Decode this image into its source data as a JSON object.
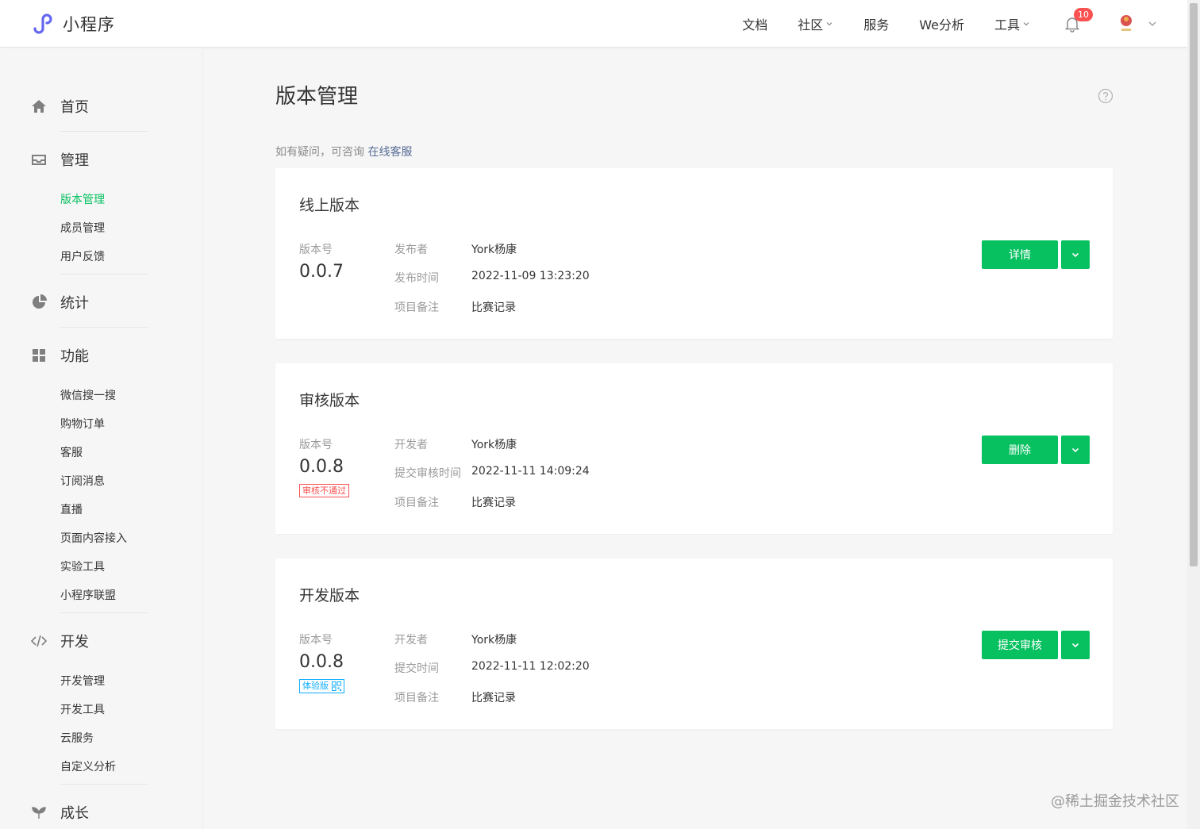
{
  "header": {
    "app_title": "小程序",
    "nav": [
      {
        "label": "文档",
        "has_dropdown": false
      },
      {
        "label": "社区",
        "has_dropdown": true
      },
      {
        "label": "服务",
        "has_dropdown": false
      },
      {
        "label": "We分析",
        "has_dropdown": false
      },
      {
        "label": "工具",
        "has_dropdown": true
      }
    ],
    "notification_count": "10"
  },
  "sidebar": {
    "sections": [
      {
        "label": "首页",
        "icon": "home-icon",
        "items": []
      },
      {
        "label": "管理",
        "icon": "inbox-icon",
        "items": [
          "版本管理",
          "成员管理",
          "用户反馈"
        ]
      },
      {
        "label": "统计",
        "icon": "pie-chart-icon",
        "items": []
      },
      {
        "label": "功能",
        "icon": "grid-icon",
        "items": [
          "微信搜一搜",
          "购物订单",
          "客服",
          "订阅消息",
          "直播",
          "页面内容接入",
          "实验工具",
          "小程序联盟"
        ]
      },
      {
        "label": "开发",
        "icon": "code-icon",
        "items": [
          "开发管理",
          "开发工具",
          "云服务",
          "自定义分析"
        ]
      },
      {
        "label": "成长",
        "icon": "sprout-icon",
        "items": []
      }
    ],
    "active_item": "版本管理"
  },
  "main": {
    "title": "版本管理",
    "hint_prefix": "如有疑问，可咨询",
    "hint_link": "在线客服",
    "cards": [
      {
        "title": "线上版本",
        "version_label": "版本号",
        "version": "0.0.7",
        "tag": "",
        "meta": [
          {
            "key": "发布者",
            "value": "York杨康"
          },
          {
            "key": "发布时间",
            "value": "2022-11-09 13:23:20"
          },
          {
            "key": "项目备注",
            "value": "比赛记录"
          }
        ],
        "button": "详情"
      },
      {
        "title": "审核版本",
        "version_label": "版本号",
        "version": "0.0.8",
        "tag": "审核不通过",
        "meta": [
          {
            "key": "开发者",
            "value": "York杨康"
          },
          {
            "key": "提交审核时间",
            "value": "2022-11-11 14:09:24"
          },
          {
            "key": "项目备注",
            "value": "比赛记录"
          }
        ],
        "button": "删除"
      },
      {
        "title": "开发版本",
        "version_label": "版本号",
        "version": "0.0.8",
        "tag": "体验版",
        "meta": [
          {
            "key": "开发者",
            "value": "York杨康"
          },
          {
            "key": "提交时间",
            "value": "2022-11-11 12:02:20"
          },
          {
            "key": "项目备注",
            "value": "比赛记录"
          }
        ],
        "button": "提交审核"
      }
    ]
  },
  "watermark": "@稀土掘金技术社区",
  "colors": {
    "accent": "#07c160",
    "link": "#576b95",
    "danger": "#fa5151",
    "info": "#10aeff"
  }
}
